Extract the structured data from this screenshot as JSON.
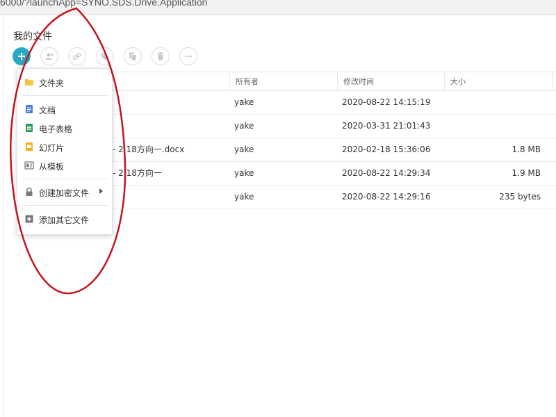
{
  "browser": {
    "url": "6000/?launchApp=SYNO.SDS.Drive.Application"
  },
  "page": {
    "title": "我的文件"
  },
  "toolbar": {
    "buttons": [
      {
        "icon": "plus-icon"
      },
      {
        "icon": "add-user-icon"
      },
      {
        "icon": "link-icon"
      },
      {
        "icon": "tag-icon"
      },
      {
        "icon": "copy-icon"
      },
      {
        "icon": "trash-icon"
      },
      {
        "icon": "more-icon"
      }
    ]
  },
  "table": {
    "columns": [
      "所有者",
      "修改时间",
      "大小"
    ],
    "rows": [
      {
        "name": "",
        "owner": "yake",
        "modified": "2020-08-22 14:15:19",
        "size": ""
      },
      {
        "name": "",
        "owner": "yake",
        "modified": "2020-03-31 21:01:43",
        "size": ""
      },
      {
        "name": "- 2.18方向一.docx",
        "owner": "yake",
        "modified": "2020-02-18 15:36:06",
        "size": "1.8 MB"
      },
      {
        "name": "- 2.18方向一",
        "owner": "yake",
        "modified": "2020-08-22 14:29:34",
        "size": "1.9 MB"
      },
      {
        "name": "",
        "owner": "yake",
        "modified": "2020-08-22 14:29:16",
        "size": "235 bytes"
      }
    ]
  },
  "menu": {
    "items": [
      {
        "label": "文件夹",
        "icon": "folder-icon"
      },
      {
        "label": "文档",
        "icon": "document-icon"
      },
      {
        "label": "电子表格",
        "icon": "spreadsheet-icon"
      },
      {
        "label": "幻灯片",
        "icon": "slides-icon"
      },
      {
        "label": "从模板",
        "icon": "template-icon"
      },
      {
        "label": "创建加密文件",
        "icon": "lock-icon"
      },
      {
        "label": "添加其它文件",
        "icon": "add-file-icon"
      }
    ]
  },
  "colors": {
    "accent": "#29a8c4",
    "annotation": "#c0161c",
    "folder": "#f5b820",
    "document": "#4a7fd8",
    "spreadsheet": "#2e9a5a",
    "slides": "#f2b21b"
  }
}
